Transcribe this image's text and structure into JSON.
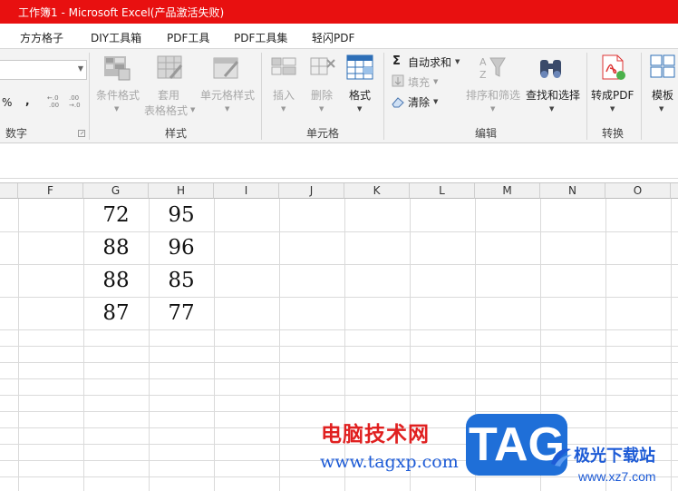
{
  "window": {
    "title": "工作簿1 - Microsoft Excel(产品激活失败)"
  },
  "menu_tabs": [
    "方方格子",
    "DIY工具箱",
    "PDF工具",
    "PDF工具集",
    "轻闪PDF"
  ],
  "ribbon": {
    "number": {
      "percent": "%",
      "comma": ",",
      "inc_decimal": ".00",
      "dec_decimal": ".00",
      "group_label": "数字"
    },
    "styles": {
      "conditional_format": "条件格式",
      "table_format_1": "套用",
      "table_format_2": "表格格式",
      "cell_styles": "单元格样式",
      "group_label": "样式"
    },
    "cells": {
      "insert": "插入",
      "delete": "删除",
      "format": "格式",
      "group_label": "单元格"
    },
    "editing": {
      "autosum": "自动求和",
      "fill": "填充",
      "clear": "清除",
      "sort_filter": "排序和筛选",
      "find_select": "查找和选择",
      "group_label": "编辑"
    },
    "convert": {
      "to_pdf": "转成PDF",
      "group_label": "转换"
    },
    "template": {
      "label": "模板"
    }
  },
  "columns": [
    "F",
    "G",
    "H",
    "I",
    "J",
    "K",
    "L",
    "M",
    "N",
    "O"
  ],
  "cells": [
    {
      "g": "72",
      "h": "95"
    },
    {
      "g": "88",
      "h": "96"
    },
    {
      "g": "88",
      "h": "85"
    },
    {
      "g": "87",
      "h": "77"
    }
  ],
  "watermark": {
    "site_cn": "电脑技术网",
    "site_url": "www.tagxp.com",
    "tag": "TAG",
    "brand_cn": "极光下载站",
    "brand_url": "www.xz7.com"
  },
  "colors": {
    "titlebar": "#e81010",
    "watermark_red": "#e02020",
    "watermark_blue": "#1d5bd6",
    "tag_box": "#1f6fd8"
  }
}
